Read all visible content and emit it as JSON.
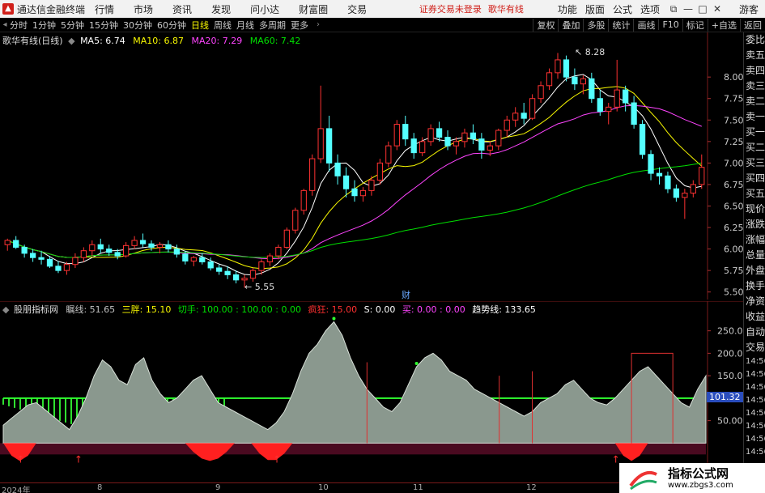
{
  "app": {
    "title": "通达信金融终端",
    "menus": [
      "行情",
      "市场",
      "资讯",
      "发现",
      "问小达",
      "财富圈",
      "交易"
    ],
    "notice": "证券交易未登录",
    "stock_name_top": "歌华有线",
    "right_menus": [
      "功能",
      "版面",
      "公式",
      "选项"
    ],
    "guest": "游客",
    "window_buttons": [
      "⧉",
      "—",
      "□",
      "✕"
    ]
  },
  "toolbar": {
    "periods": [
      "分时",
      "1分钟",
      "5分钟",
      "15分钟",
      "30分钟",
      "60分钟",
      "日线",
      "周线",
      "月线",
      "多周期",
      "更多"
    ],
    "active_period": "日线",
    "right_buttons": [
      "复权",
      "叠加",
      "多股",
      "统计",
      "画线",
      "F10",
      "标记",
      "+自选",
      "返回"
    ]
  },
  "main_legend": {
    "title": "歌华有线(日线)",
    "ma": [
      {
        "label": "MA5: 6.74",
        "color": "#ffffff"
      },
      {
        "label": "MA10: 6.87",
        "color": "#f8f800"
      },
      {
        "label": "MA20: 7.29",
        "color": "#ff44ff"
      },
      {
        "label": "MA60: 7.42",
        "color": "#00e000"
      }
    ],
    "high_mark": "8.28",
    "low_mark": "5.55",
    "event_mark": "财"
  },
  "ind_legend": {
    "name": "股朋指标网",
    "items": [
      {
        "label": "瞩线: 51.65",
        "color": "#c0c0c0"
      },
      {
        "label": "三胖: 15.10",
        "color": "#f8f800"
      },
      {
        "label": "切手: 100.00 : 100.00 : 0.00",
        "color": "#00e000"
      },
      {
        "label": "疯狂: 15.00",
        "color": "#ff3030"
      },
      {
        "label": "S: 0.00",
        "color": "#ffffff"
      },
      {
        "label": "买: 0.00 : 0.00",
        "color": "#ff44ff"
      },
      {
        "label": "趋势线: 133.65",
        "color": "#ffffff"
      }
    ],
    "current_value": "101.32"
  },
  "price_axis": [
    "8.00",
    "7.75",
    "7.50",
    "7.25",
    "7.00",
    "6.75",
    "6.50",
    "6.25",
    "6.00",
    "5.75",
    "5.50"
  ],
  "ind_axis": [
    "250.0",
    "200.0",
    "150.0",
    "100.0",
    "50.00"
  ],
  "x_labels": [
    "2024年",
    "8",
    "9",
    "10",
    "11",
    "12"
  ],
  "side_panel": {
    "top": "委比",
    "items": [
      "卖五",
      "卖四",
      "卖三",
      "卖二",
      "卖一",
      "买一",
      "买二",
      "买三",
      "买四",
      "买五",
      "现价",
      "涨跌",
      "涨幅",
      "总量",
      "外盘",
      "换手",
      "净资",
      "收益",
      "自动",
      "交易"
    ],
    "times": [
      "14:56",
      "14:56",
      "14:56",
      "14:56",
      "14:56",
      "14:56",
      "14:56",
      "14:56"
    ]
  },
  "watermark": {
    "title": "指标公式网",
    "url": "www.zbgs3.com"
  },
  "chart_data": [
    {
      "type": "candlestick",
      "title": "歌华有线(日线)",
      "ylim": [
        5.45,
        8.35
      ],
      "candles": [
        [
          6.05,
          6.12,
          5.98,
          6.1
        ],
        [
          6.1,
          6.15,
          6.0,
          6.02
        ],
        [
          6.02,
          6.05,
          5.9,
          5.95
        ],
        [
          5.95,
          6.0,
          5.85,
          5.9
        ],
        [
          5.9,
          5.98,
          5.82,
          5.88
        ],
        [
          5.88,
          5.92,
          5.78,
          5.8
        ],
        [
          5.8,
          5.86,
          5.72,
          5.75
        ],
        [
          5.75,
          5.85,
          5.7,
          5.82
        ],
        [
          5.82,
          5.95,
          5.78,
          5.9
        ],
        [
          5.9,
          6.02,
          5.85,
          5.98
        ],
        [
          5.98,
          6.1,
          5.92,
          6.05
        ],
        [
          6.05,
          6.12,
          5.95,
          6.0
        ],
        [
          6.0,
          6.05,
          5.92,
          5.96
        ],
        [
          5.96,
          6.0,
          5.88,
          5.92
        ],
        [
          5.92,
          6.08,
          5.9,
          6.04
        ],
        [
          6.04,
          6.15,
          6.0,
          6.1
        ],
        [
          6.1,
          6.18,
          6.02,
          6.06
        ],
        [
          6.06,
          6.1,
          5.98,
          6.02
        ],
        [
          6.02,
          6.08,
          5.95,
          6.05
        ],
        [
          6.05,
          6.1,
          5.96,
          6.0
        ],
        [
          6.0,
          6.05,
          5.9,
          5.94
        ],
        [
          5.94,
          5.98,
          5.82,
          5.86
        ],
        [
          5.86,
          5.92,
          5.8,
          5.9
        ],
        [
          5.9,
          5.95,
          5.82,
          5.85
        ],
        [
          5.85,
          5.9,
          5.75,
          5.78
        ],
        [
          5.78,
          5.82,
          5.7,
          5.74
        ],
        [
          5.74,
          5.8,
          5.65,
          5.7
        ],
        [
          5.7,
          5.75,
          5.6,
          5.64
        ],
        [
          5.64,
          5.7,
          5.55,
          5.66
        ],
        [
          5.66,
          5.78,
          5.62,
          5.75
        ],
        [
          5.75,
          5.88,
          5.7,
          5.85
        ],
        [
          5.85,
          5.95,
          5.8,
          5.92
        ],
        [
          5.92,
          6.05,
          5.88,
          6.02
        ],
        [
          6.02,
          6.25,
          6.0,
          6.22
        ],
        [
          6.22,
          6.48,
          6.18,
          6.45
        ],
        [
          6.45,
          6.7,
          6.4,
          6.68
        ],
        [
          6.68,
          7.1,
          6.62,
          7.05
        ],
        [
          7.05,
          7.9,
          7.0,
          7.4
        ],
        [
          7.4,
          7.55,
          6.9,
          7.0
        ],
        [
          7.0,
          7.1,
          6.75,
          6.85
        ],
        [
          6.85,
          6.95,
          6.6,
          6.7
        ],
        [
          6.7,
          6.8,
          6.55,
          6.62
        ],
        [
          6.62,
          6.72,
          6.55,
          6.68
        ],
        [
          6.68,
          6.85,
          6.62,
          6.8
        ],
        [
          6.8,
          7.05,
          6.75,
          7.0
        ],
        [
          7.0,
          7.25,
          6.95,
          7.2
        ],
        [
          7.2,
          7.5,
          7.15,
          7.45
        ],
        [
          7.45,
          7.55,
          7.2,
          7.28
        ],
        [
          7.28,
          7.35,
          7.05,
          7.12
        ],
        [
          7.12,
          7.3,
          7.08,
          7.25
        ],
        [
          7.25,
          7.45,
          7.2,
          7.4
        ],
        [
          7.4,
          7.48,
          7.25,
          7.3
        ],
        [
          7.3,
          7.38,
          7.15,
          7.2
        ],
        [
          7.2,
          7.3,
          7.1,
          7.25
        ],
        [
          7.25,
          7.4,
          7.18,
          7.35
        ],
        [
          7.35,
          7.45,
          7.22,
          7.28
        ],
        [
          7.28,
          7.35,
          7.05,
          7.15
        ],
        [
          7.15,
          7.25,
          7.08,
          7.2
        ],
        [
          7.2,
          7.4,
          7.15,
          7.38
        ],
        [
          7.38,
          7.55,
          7.3,
          7.5
        ],
        [
          7.5,
          7.65,
          7.42,
          7.58
        ],
        [
          7.58,
          7.7,
          7.45,
          7.52
        ],
        [
          7.52,
          7.8,
          7.5,
          7.75
        ],
        [
          7.75,
          7.95,
          7.7,
          7.9
        ],
        [
          7.9,
          8.1,
          7.85,
          8.05
        ],
        [
          8.05,
          8.28,
          7.98,
          8.2
        ],
        [
          8.2,
          8.25,
          7.95,
          8.0
        ],
        [
          8.0,
          8.1,
          7.85,
          7.92
        ],
        [
          7.92,
          8.02,
          7.8,
          7.98
        ],
        [
          7.98,
          8.05,
          7.7,
          7.75
        ],
        [
          7.75,
          7.85,
          7.55,
          7.6
        ],
        [
          7.6,
          7.7,
          7.45,
          7.65
        ],
        [
          7.65,
          8.2,
          7.6,
          7.85
        ],
        [
          7.85,
          7.9,
          7.6,
          7.7
        ],
        [
          7.7,
          7.78,
          7.4,
          7.45
        ],
        [
          7.45,
          7.5,
          7.05,
          7.1
        ],
        [
          7.1,
          7.15,
          6.8,
          6.88
        ],
        [
          6.88,
          6.95,
          6.75,
          6.85
        ],
        [
          6.85,
          6.9,
          6.65,
          6.7
        ],
        [
          6.7,
          6.75,
          6.55,
          6.6
        ],
        [
          6.6,
          6.7,
          6.35,
          6.65
        ],
        [
          6.65,
          6.8,
          6.6,
          6.75
        ],
        [
          6.75,
          7.1,
          6.7,
          6.95
        ]
      ]
    },
    {
      "type": "area",
      "title": "股朋指标网",
      "ylim": [
        -30,
        280
      ],
      "values": [
        40,
        55,
        70,
        85,
        90,
        75,
        60,
        45,
        30,
        60,
        100,
        150,
        185,
        170,
        140,
        130,
        175,
        190,
        140,
        110,
        90,
        100,
        120,
        140,
        150,
        120,
        90,
        80,
        70,
        60,
        50,
        40,
        30,
        45,
        70,
        110,
        160,
        200,
        220,
        250,
        270,
        240,
        190,
        150,
        120,
        100,
        80,
        70,
        90,
        130,
        170,
        190,
        200,
        185,
        160,
        150,
        140,
        120,
        110,
        100,
        90,
        80,
        70,
        60,
        70,
        90,
        100,
        110,
        130,
        140,
        120,
        100,
        90,
        85,
        100,
        120,
        140,
        160,
        170,
        150,
        130,
        110,
        90,
        80,
        120,
        150
      ]
    }
  ]
}
